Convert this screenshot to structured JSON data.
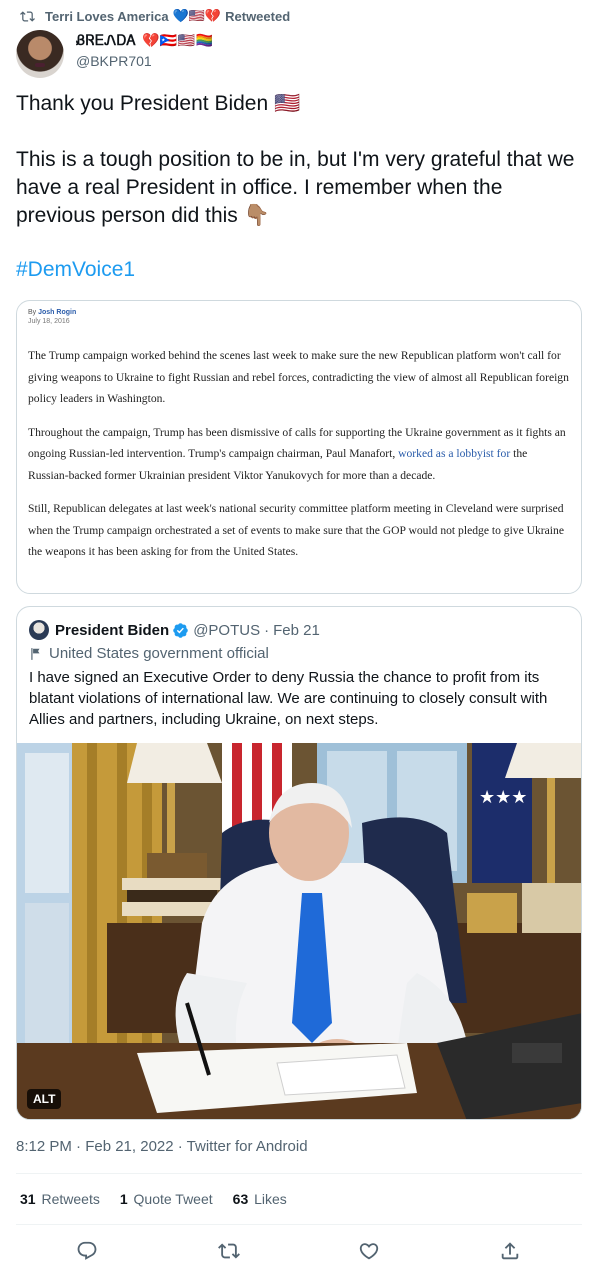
{
  "retweet": {
    "user": "Terri Loves America",
    "flags": "💙🇺🇸💔",
    "label": "Retweeted"
  },
  "author": {
    "display_name": "ᏰᏒᎬᏁᎠᎪ 💔🇵🇷🇺🇸🏳️‍🌈",
    "handle": "@BKPR701"
  },
  "tweet": {
    "text": "Thank you President Biden 🇺🇸\n\nThis is a tough position to be in, but I'm very grateful that we have a real President in office. I remember when the previous person did this 👇🏽",
    "hashtag": "#DemVoice1"
  },
  "article": {
    "by_prefix": "By",
    "author": "Josh Rogin",
    "date": "July 18, 2016",
    "p1": "The Trump campaign worked behind the scenes last week to make sure the new Republican platform won't call for giving weapons to Ukraine to fight Russian and rebel forces, contradicting the view of almost all Republican foreign policy leaders in Washington.",
    "p2_a": "Throughout the campaign, Trump has been dismissive of calls for supporting the Ukraine government as it fights an ongoing Russian-led intervention. Trump's campaign chairman, Paul Manafort, ",
    "p2_link": "worked as a lobbyist for",
    "p2_b": " the Russian-backed former Ukrainian president Viktor Yanukovych for more than a decade.",
    "p3": "Still, Republican delegates at last week's national security committee platform meeting in Cleveland were surprised when the Trump campaign orchestrated a set of events to make sure that the GOP would not pledge to give Ukraine the weapons it has been asking for from the United States."
  },
  "quote": {
    "name": "President Biden",
    "handle": "@POTUS",
    "date": "Feb 21",
    "label": "United States government official",
    "text": "I have signed an Executive Order to deny Russia the chance to profit from its blatant violations of international law. We are continuing to closely consult with Allies and partners, including Ukraine, on next steps.",
    "alt_badge": "ALT"
  },
  "meta": {
    "timestamp": "8:12 PM · Feb 21, 2022 · Twitter for Android"
  },
  "stats": {
    "retweets_count": "31",
    "retweets_label": "Retweets",
    "quotes_count": "1",
    "quotes_label": "Quote Tweet",
    "likes_count": "63",
    "likes_label": "Likes"
  },
  "actions": [
    "reply-icon",
    "retweet-icon",
    "like-icon",
    "share-icon"
  ],
  "colors": {
    "accent": "#1d9bf0",
    "muted": "#536471",
    "text": "#0f1419",
    "border": "#cfd9de"
  }
}
